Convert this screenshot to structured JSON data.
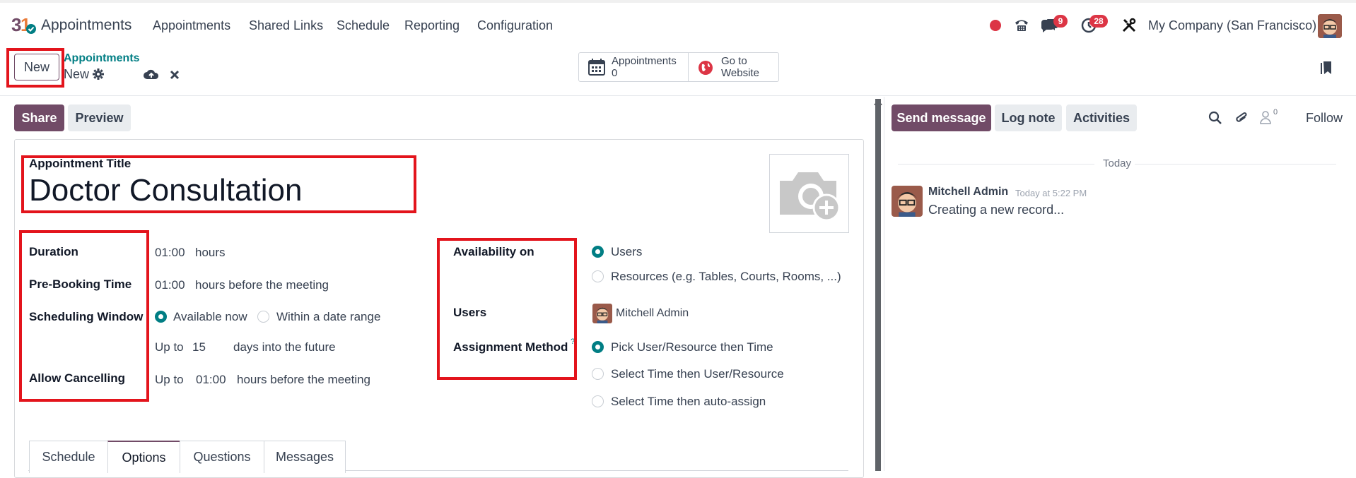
{
  "app": {
    "name": "Appointments"
  },
  "menu": [
    "Appointments",
    "Shared Links",
    "Schedule",
    "Reporting",
    "Configuration"
  ],
  "systray": {
    "messages_badge": "9",
    "activities_badge": "28",
    "company": "My Company (San Francisco)"
  },
  "control": {
    "new_label": "New",
    "breadcrumb_parent": "Appointments",
    "breadcrumb_current": "New",
    "stat_appointments_label": "Appointments",
    "stat_appointments_count": "0",
    "stat_website_line1": "Go to",
    "stat_website_line2": "Website"
  },
  "form": {
    "share_label": "Share",
    "preview_label": "Preview",
    "title_label": "Appointment Title",
    "title_value": "Doctor Consultation",
    "duration_label": "Duration",
    "duration_value": "01:00",
    "duration_unit": "hours",
    "prebook_label": "Pre-Booking Time",
    "prebook_value": "01:00",
    "prebook_unit": "hours before the meeting",
    "window_label": "Scheduling Window",
    "window_opt1": "Available now",
    "window_opt2": "Within a date range",
    "upto_label": "Up to",
    "upto_value": "15",
    "upto_unit": "days into the future",
    "cancel_label": "Allow Cancelling",
    "cancel_prefix": "Up to",
    "cancel_value": "01:00",
    "cancel_unit": "hours before the meeting",
    "avail_label": "Availability on",
    "avail_opt1": "Users",
    "avail_opt2": "Resources (e.g. Tables, Courts, Rooms, ...)",
    "users_label": "Users",
    "users_value": "Mitchell Admin",
    "assign_label": "Assignment Method",
    "assign_help": "?",
    "assign_opt1": "Pick User/Resource then Time",
    "assign_opt2": "Select Time then User/Resource",
    "assign_opt3": "Select Time then auto-assign"
  },
  "tabs": [
    "Schedule",
    "Options",
    "Questions",
    "Messages"
  ],
  "chatter": {
    "send_label": "Send message",
    "log_label": "Log note",
    "activities_label": "Activities",
    "followers_count": "0",
    "follow_label": "Follow",
    "date_separator": "Today",
    "author": "Mitchell Admin",
    "time": "Today at 5:22 PM",
    "message": "Creating a new record..."
  },
  "colors": {
    "brand": "#714b67",
    "accent": "#017e84",
    "highlight": "#e3141c",
    "badge": "#dc3545"
  }
}
